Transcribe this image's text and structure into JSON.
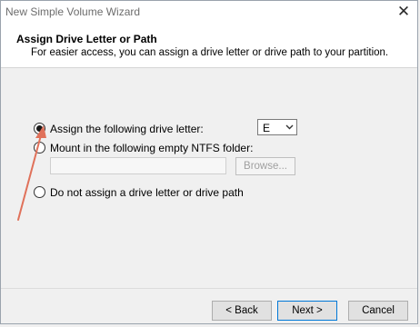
{
  "window": {
    "title": "New Simple Volume Wizard",
    "close_glyph": "✕"
  },
  "header": {
    "title": "Assign Drive Letter or Path",
    "subtitle": "For easier access, you can assign a drive letter or drive path to your partition."
  },
  "options": {
    "assign_letter": {
      "label": "Assign the following drive letter:",
      "selected": true
    },
    "mount_folder": {
      "label": "Mount in the following empty NTFS folder:",
      "selected": false
    },
    "no_assign": {
      "label": "Do not assign a drive letter or drive path",
      "selected": false
    }
  },
  "drive_letter": {
    "value": "E"
  },
  "folder_path": {
    "value": ""
  },
  "browse": {
    "label": "Browse..."
  },
  "footer": {
    "back_label": "< Back",
    "next_label": "Next >",
    "cancel_label": "Cancel"
  },
  "annotation": {
    "arrow_color": "#e0715a"
  },
  "colors": {
    "accent": "#0078d7"
  }
}
